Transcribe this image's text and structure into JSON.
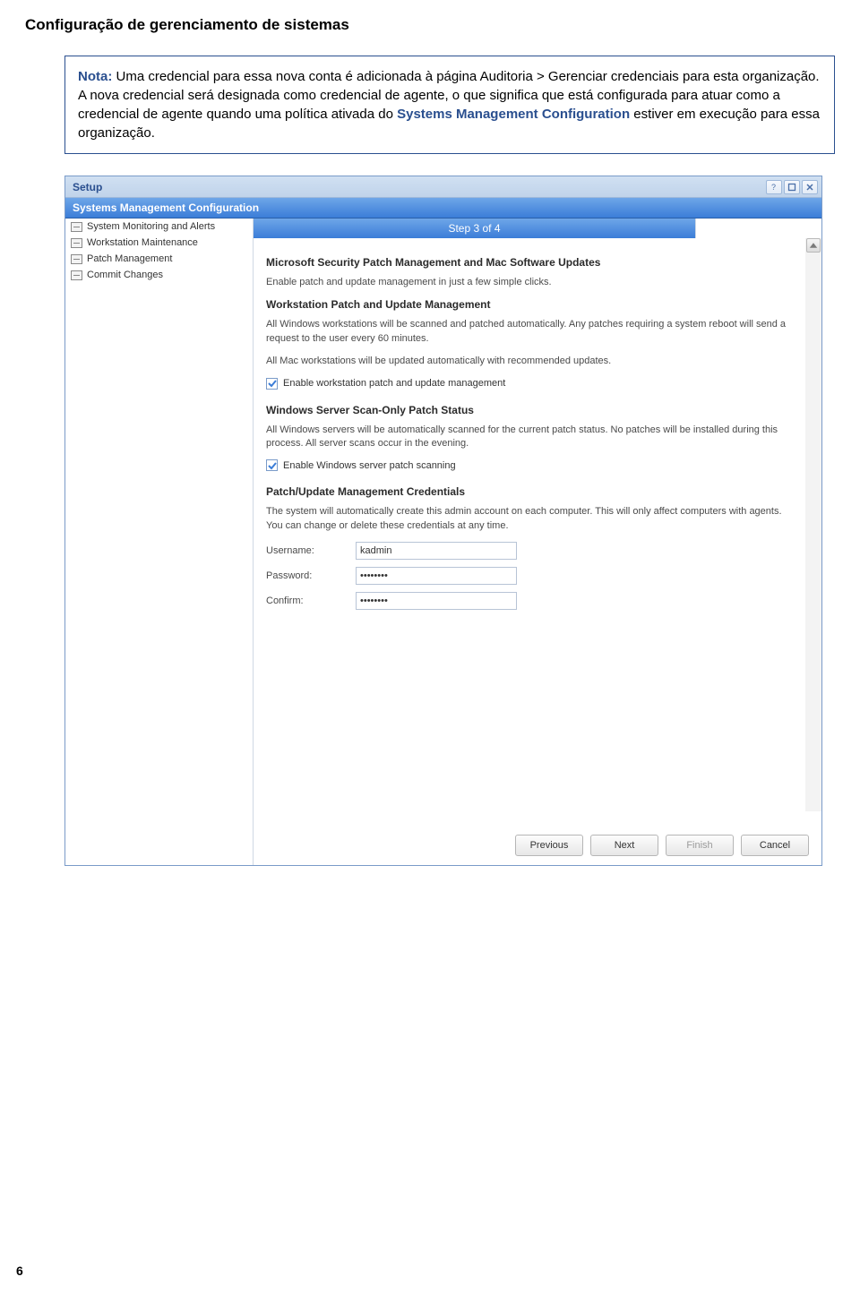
{
  "page": {
    "title": "Configuração de gerenciamento de sistemas",
    "number": "6"
  },
  "note": {
    "label": "Nota:",
    "text1": " Uma credencial para essa nova conta é adicionada à página Auditoria > Gerenciar credenciais para esta organização. A nova credencial será designada como credencial de agente, o que significa que está configurada para atuar como a credencial de agente quando uma política ativada do ",
    "smc": "Systems Management Configuration",
    "text2": " estiver em execução para essa organização."
  },
  "window": {
    "title": "Setup",
    "section_header": "Systems Management Configuration",
    "step_label": "Step 3 of 4",
    "sidebar": [
      "System Monitoring and Alerts",
      "Workstation Maintenance",
      "Patch Management",
      "Commit Changes"
    ],
    "blocks": {
      "b1_title": "Microsoft Security Patch Management and Mac Software Updates",
      "b1_text": "Enable patch and update management in just a few simple clicks.",
      "b2_title": "Workstation Patch and Update Management",
      "b2_text1": "All Windows workstations will be scanned and patched automatically. Any patches requiring a system reboot will send a request to the user every 60 minutes.",
      "b2_text2": "All Mac workstations will be updated automatically with recommended updates.",
      "b2_check": "Enable workstation patch and update management",
      "b3_title": "Windows Server Scan-Only Patch Status",
      "b3_text": "All Windows servers will be automatically scanned for the current patch status. No patches will be installed during this process. All server scans occur in the evening.",
      "b3_check": "Enable Windows server patch scanning",
      "b4_title": "Patch/Update Management Credentials",
      "b4_text": "The system will automatically create this admin account on each computer. This will only affect computers with agents. You can change or delete these credentials at any time.",
      "cred_username_label": "Username:",
      "cred_username_value": "kadmin",
      "cred_password_label": "Password:",
      "cred_password_value": "********",
      "cred_confirm_label": "Confirm:",
      "cred_confirm_value": "********"
    },
    "buttons": {
      "previous": "Previous",
      "next": "Next",
      "finish": "Finish",
      "cancel": "Cancel"
    }
  }
}
